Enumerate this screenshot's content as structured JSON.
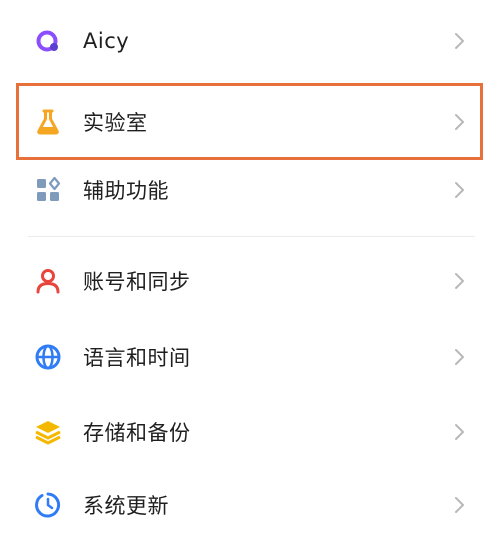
{
  "settings": {
    "items": [
      {
        "label": "Aicy",
        "icon": "aicy-icon",
        "color": "#8b4dff"
      },
      {
        "label": "实验室",
        "icon": "flask-icon",
        "color": "#f5a623"
      },
      {
        "label": "辅助功能",
        "icon": "accessibility-grid-icon",
        "color": "#6b8fb3"
      },
      {
        "label": "账号和同步",
        "icon": "person-icon",
        "color": "#e8453c"
      },
      {
        "label": "语言和时间",
        "icon": "globe-icon",
        "color": "#2f7cf6"
      },
      {
        "label": "存储和备份",
        "icon": "layers-icon",
        "color": "#f5b800"
      },
      {
        "label": "系统更新",
        "icon": "update-icon",
        "color": "#2f7cf6"
      }
    ]
  },
  "colors": {
    "highlight_border": "#e8703a",
    "chevron": "#b8b8b8",
    "text": "#1f1f1f"
  }
}
